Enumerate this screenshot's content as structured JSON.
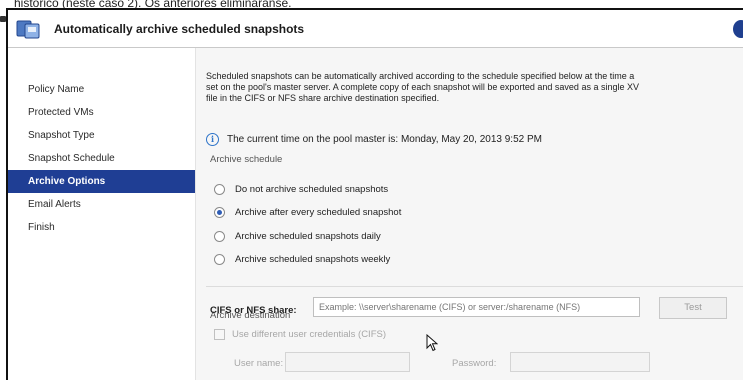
{
  "caption": "histórico (neste caso 2). Os anteriores eliminaranse.",
  "header": {
    "title": "Automatically archive scheduled snapshots",
    "icon": "snapshot-icon",
    "help_icon": "help-icon"
  },
  "sidebar": {
    "items": [
      {
        "label": "Policy Name",
        "active": false
      },
      {
        "label": "Protected VMs",
        "active": false
      },
      {
        "label": "Snapshot Type",
        "active": false
      },
      {
        "label": "Snapshot Schedule",
        "active": false
      },
      {
        "label": "Archive Options",
        "active": true
      },
      {
        "label": "Email Alerts",
        "active": false
      },
      {
        "label": "Finish",
        "active": false
      }
    ]
  },
  "content": {
    "intro_line1": "Scheduled snapshots can be automatically archived according to the schedule specified below at the time a",
    "intro_line2": "set on the pool's master server. A complete copy of each snapshot will be exported and saved as a single XV",
    "intro_line3": "file in the CIFS or NFS share archive destination specified.",
    "info_text": "The current time on the pool master is: Monday, May 20, 2013 9:52 PM",
    "archive_schedule_label": "Archive schedule",
    "options": [
      {
        "label": "Do not archive scheduled snapshots",
        "checked": false
      },
      {
        "label": "Archive after every scheduled snapshot",
        "checked": true
      },
      {
        "label": "Archive scheduled snapshots daily",
        "checked": false
      },
      {
        "label": "Archive scheduled snapshots weekly",
        "checked": false
      }
    ],
    "archive_destination_label": "Archive destination",
    "cifs_label": "CIFS or NFS share:",
    "cifs_placeholder": "Example: \\\\server\\sharename (CIFS) or server:/sharename (NFS)",
    "test_button": "Test",
    "credentials_label": "Use different user credentials (CIFS)",
    "username_label": "User name:",
    "password_label": "Password:"
  },
  "colors": {
    "active_nav_bg": "#1f3e94",
    "info_icon": "#2e74c9",
    "content_bg": "#f6f6f6"
  }
}
